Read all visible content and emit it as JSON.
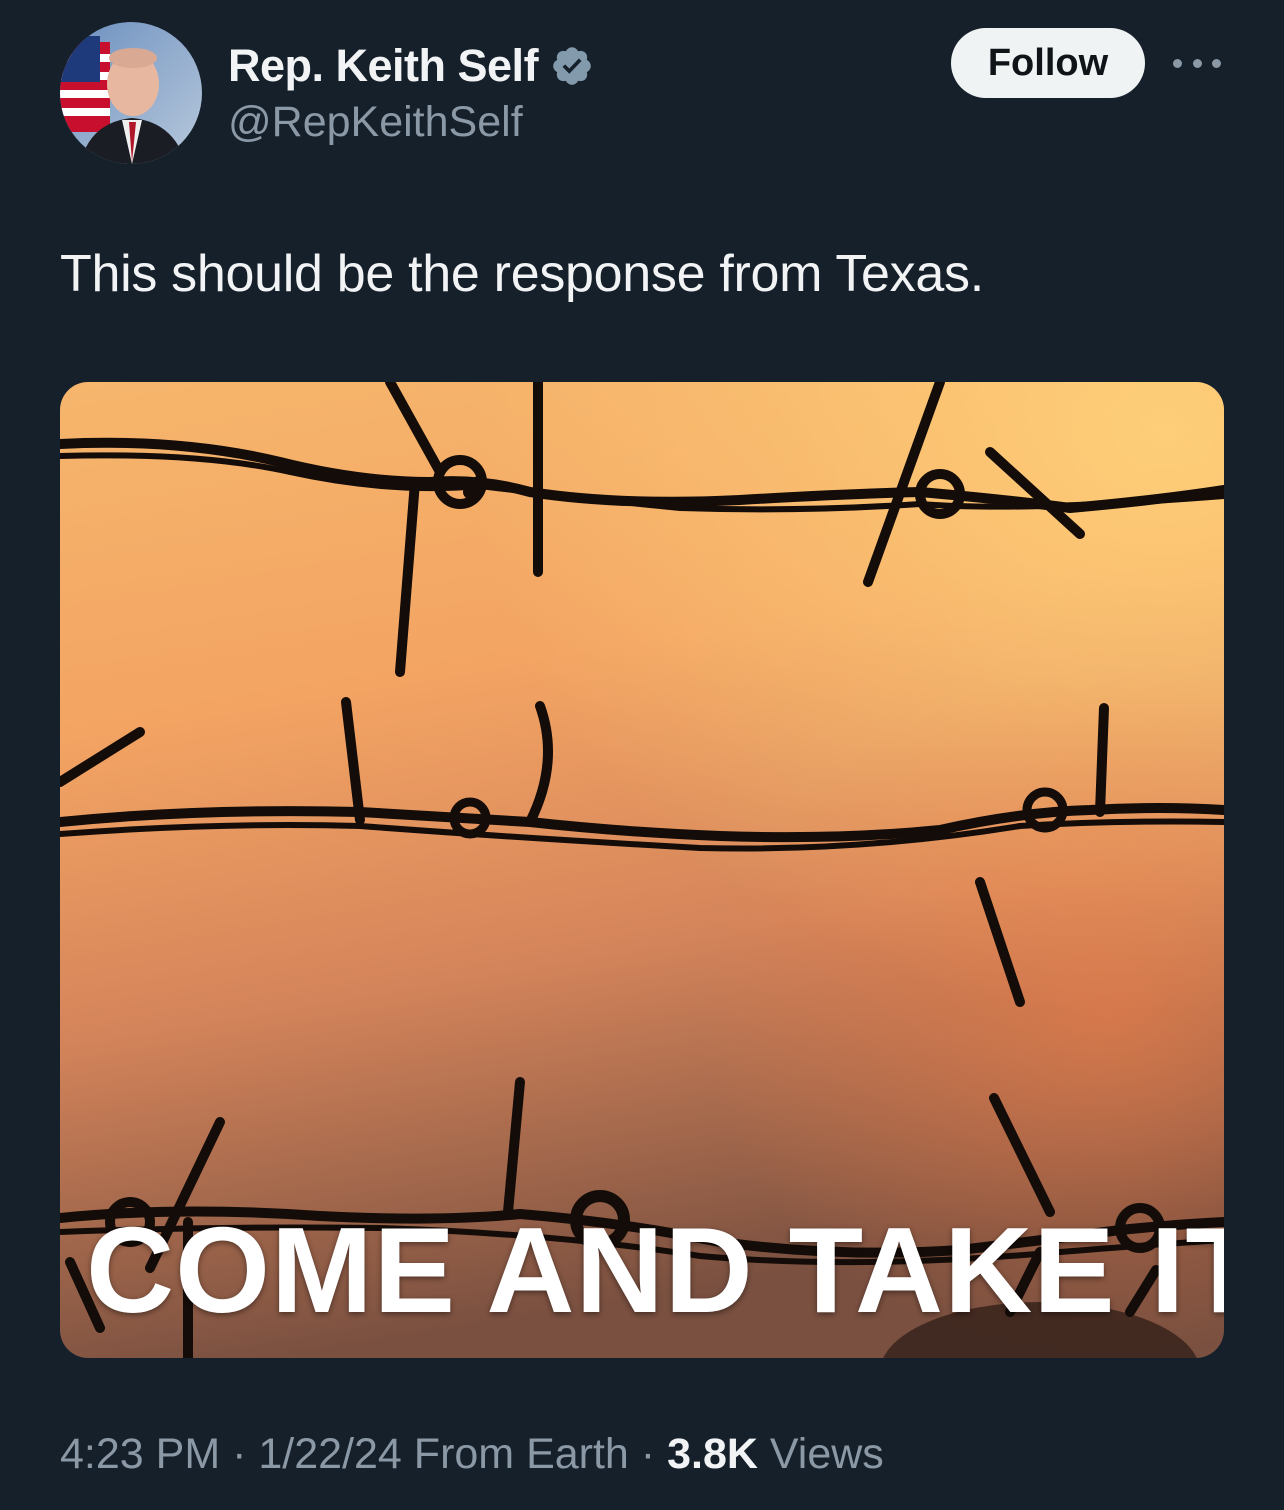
{
  "author": {
    "display_name": "Rep. Keith Self",
    "handle": "@RepKeithSelf",
    "verified_icon": "verified-badge-icon",
    "avatar_icon": "avatar"
  },
  "actions": {
    "follow_label": "Follow",
    "more_icon": "more-options-icon"
  },
  "tweet": {
    "text": "This should be the response from Texas.",
    "media": {
      "overlay_text": "COME AND TAKE IT"
    }
  },
  "meta": {
    "time": "4:23 PM",
    "separator": "·",
    "date": "1/22/24",
    "source": "From Earth",
    "views_count": "3.8K",
    "views_label": "Views"
  },
  "colors": {
    "background": "#16202b",
    "primary_text": "#f1f3f4",
    "secondary_text": "#8b98a5",
    "follow_button_bg": "#eff3f4",
    "sky_top": "#f7c56c",
    "sky_bottom": "#8e5a45"
  }
}
